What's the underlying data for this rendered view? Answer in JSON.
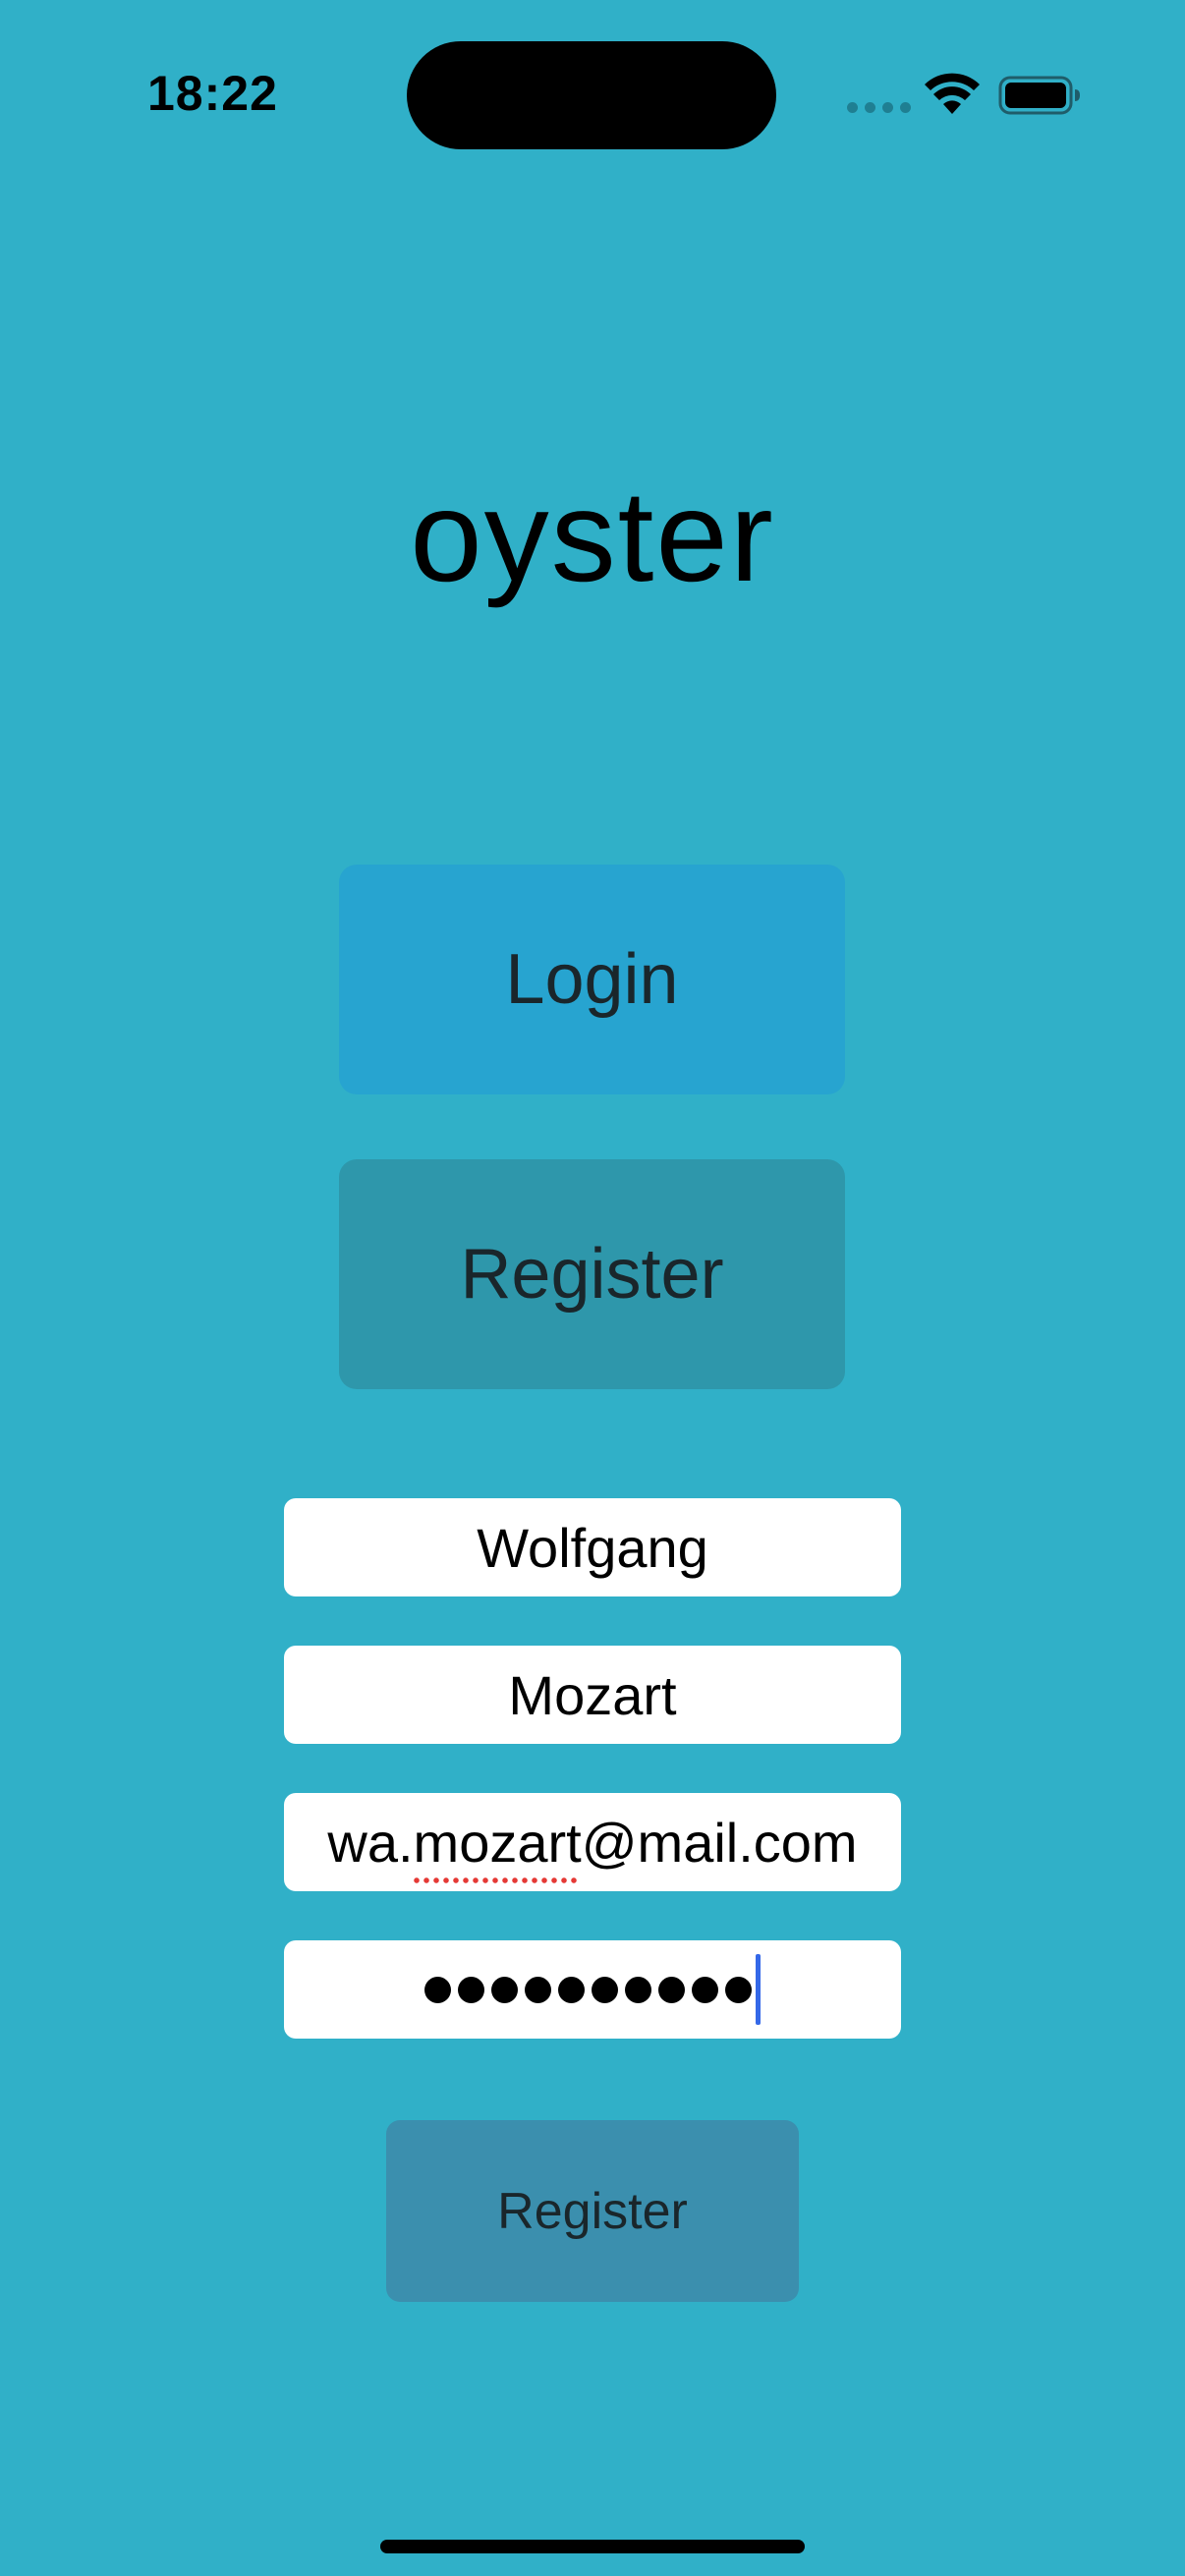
{
  "status_bar": {
    "time": "18:22"
  },
  "app": {
    "title": "oyster"
  },
  "buttons": {
    "login_label": "Login",
    "register_label": "Register",
    "submit_label": "Register"
  },
  "form": {
    "first_name": "Wolfgang",
    "last_name": "Mozart",
    "email": "wa.mozart@mail.com",
    "password_length": 10
  },
  "colors": {
    "background": "#30b0c8",
    "login_button": "#27a4d0",
    "register_button": "#2e97ab",
    "submit_button": "#3b8fae",
    "caret": "#3468e8",
    "spellcheck": "#e53935"
  },
  "icons": [
    "signal-icon",
    "wifi-icon",
    "battery-icon"
  ]
}
